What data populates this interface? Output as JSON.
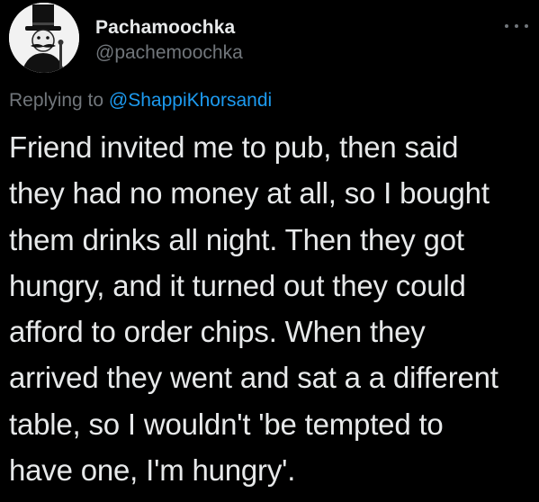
{
  "tweet": {
    "author": {
      "display_name": "Pachamoochka",
      "handle": "@pachemoochka",
      "avatar_icon": "top-hat-villain-avatar"
    },
    "more_icon": "more-options-icon",
    "reply": {
      "prefix": "Replying to",
      "mention": "@ShappiKhorsandi"
    },
    "body_lines": [
      "Friend invited me to pub, then said",
      "they had no money at all, so I bought",
      "them drinks all night. Then they got",
      "hungry, and it turned out they could",
      "afford to order chips. When they",
      "arrived they went and sat a a different",
      "table, so I wouldn't 'be tempted to",
      "have one, I'm hungry'."
    ]
  },
  "colors": {
    "background": "#000000",
    "text": "#e7e9ea",
    "secondary": "#71767b",
    "mention": "#1d9bf0"
  }
}
